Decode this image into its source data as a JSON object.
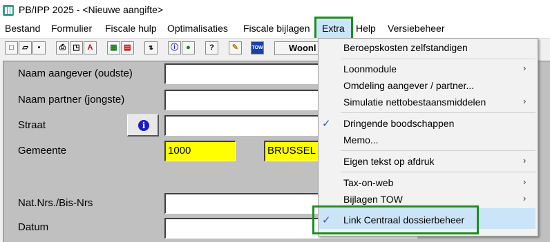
{
  "window": {
    "title": "PB/IPP 2025 - <Nieuwe aangifte>"
  },
  "menubar": {
    "items": [
      "Bestand",
      "Formulier",
      "Fiscale hulp",
      "Optimalisaties",
      "Fiscale bijlagen",
      "Extra",
      "Help",
      "Versiebeheer"
    ],
    "active": "Extra"
  },
  "toolbar": {
    "icons": [
      "new-document-icon",
      "open-folder-icon",
      "save-icon",
      "print-icon",
      "print-preview-icon",
      "pdf-icon",
      "spreadsheet-icon",
      "calculator-icon",
      "tax-calc-icon",
      "info-icon",
      "globe-icon",
      "help-icon",
      "pencil-icon",
      "tow-icon"
    ],
    "tow_label": "TOW",
    "wide_button_label": "Woonl"
  },
  "form": {
    "naam_aangever_label": "Naam aangever (oudste)",
    "naam_aangever_value": "",
    "naam_partner_label": "Naam partner (jongste)",
    "naam_partner_value": "",
    "straat_label": "Straat",
    "straat_value": "",
    "info_glyph": "i",
    "gemeente_label": "Gemeente",
    "postcode_value": "1000",
    "gemeente_value": "BRUSSEL",
    "natnrs_label": "Nat.Nrs./Bis-Nrs",
    "natnrs_value": "",
    "datum_label": "Datum",
    "datum_value": ""
  },
  "extra_menu": {
    "items": [
      {
        "label": "Beroepskosten zelfstandigen",
        "submenu": false,
        "checked": false
      },
      {
        "label": "Loonmodule",
        "submenu": true,
        "checked": false
      },
      {
        "label": "Omdeling aangever / partner...",
        "submenu": false,
        "checked": false
      },
      {
        "label": "Simulatie nettobestaansmiddelen",
        "submenu": true,
        "checked": false
      },
      {
        "label": "Dringende boodschappen",
        "submenu": false,
        "checked": true
      },
      {
        "label": "Memo...",
        "submenu": false,
        "checked": false
      },
      {
        "label": "Eigen tekst op afdruk",
        "submenu": true,
        "checked": false
      },
      {
        "label": "Tax-on-web",
        "submenu": true,
        "checked": false
      },
      {
        "label": "Bijlagen TOW",
        "submenu": true,
        "checked": false
      },
      {
        "label": "Link Centraal dossierbeheer",
        "submenu": false,
        "checked": true
      }
    ],
    "check_glyph": "✓",
    "arrow_glyph": "›"
  },
  "colors": {
    "highlight_border": "#1a8f1a",
    "menu_hover": "#cce4f7",
    "required_field": "#ffff00",
    "form_background": "#c0c0c0"
  }
}
